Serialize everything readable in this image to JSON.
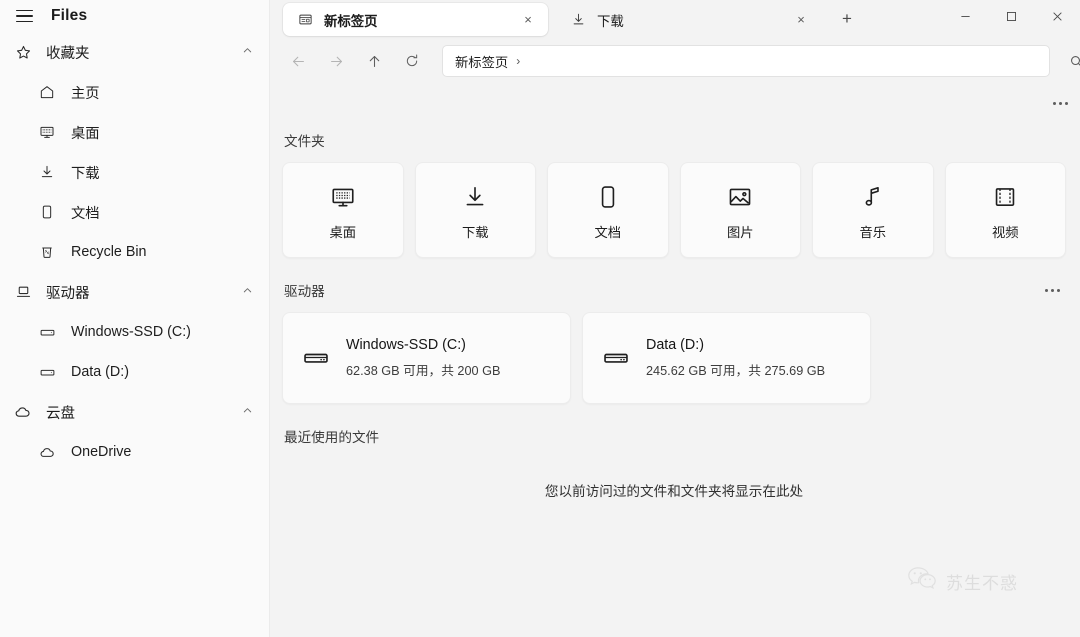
{
  "app": {
    "title": "Files",
    "menu_icon": "hamburger-icon"
  },
  "window_controls": {
    "minimize": "—",
    "maximize": "☐",
    "close": "×"
  },
  "tabs": {
    "new_tab_label": "+",
    "items": [
      {
        "label": "新标签页",
        "icon": "new-tab-page-icon",
        "active": true,
        "close": "×"
      },
      {
        "label": "下载",
        "icon": "download-icon",
        "active": false,
        "close": "×"
      }
    ]
  },
  "navigation": {
    "back": "←",
    "forward": "→",
    "up": "↑",
    "refresh": "↻",
    "search_icon": "search-icon",
    "overflow": "ellipsis-icon"
  },
  "address_bar": {
    "crumb": "新标签页",
    "separator": "›"
  },
  "sidebar": {
    "groups": [
      {
        "label": "收藏夹",
        "icon": "star-icon",
        "expanded": true,
        "items": [
          {
            "label": "主页",
            "icon": "home-icon"
          },
          {
            "label": "桌面",
            "icon": "desktop-icon"
          },
          {
            "label": "下载",
            "icon": "download-icon"
          },
          {
            "label": "文档",
            "icon": "document-icon"
          },
          {
            "label": "Recycle Bin",
            "icon": "recycle-bin-icon"
          }
        ]
      },
      {
        "label": "驱动器",
        "icon": "drives-icon",
        "expanded": true,
        "items": [
          {
            "label": "Windows-SSD (C:)",
            "icon": "drive-icon"
          },
          {
            "label": "Data (D:)",
            "icon": "drive-icon"
          }
        ]
      },
      {
        "label": "云盘",
        "icon": "cloud-icon",
        "expanded": true,
        "items": [
          {
            "label": "OneDrive",
            "icon": "cloud-icon"
          }
        ]
      }
    ]
  },
  "content": {
    "folders_section": {
      "title": "文件夹",
      "items": [
        {
          "label": "桌面",
          "icon": "desktop-icon"
        },
        {
          "label": "下载",
          "icon": "download-icon"
        },
        {
          "label": "文档",
          "icon": "document-icon"
        },
        {
          "label": "图片",
          "icon": "pictures-icon"
        },
        {
          "label": "音乐",
          "icon": "music-icon"
        },
        {
          "label": "视频",
          "icon": "video-icon"
        }
      ]
    },
    "drives_section": {
      "title": "驱动器",
      "overflow": "ellipsis-icon",
      "items": [
        {
          "name": "Windows-SSD (C:)",
          "detail": "62.38 GB 可用，共 200 GB",
          "icon": "drive-icon"
        },
        {
          "name": "Data (D:)",
          "detail": "245.62 GB 可用，共 275.69 GB",
          "icon": "drive-icon"
        }
      ]
    },
    "recent_section": {
      "title": "最近使用的文件",
      "empty_message": "您以前访问过的文件和文件夹将显示在此处"
    }
  },
  "watermark": {
    "text": "苏生不惑",
    "icon": "wechat-icon"
  },
  "colors": {
    "window_bg": "#f3f3f3",
    "sidebar_bg": "#fafafa",
    "card_bg": "#fbfbfb",
    "active_tab_bg": "#ffffff",
    "text_primary": "#1a1a1a"
  }
}
